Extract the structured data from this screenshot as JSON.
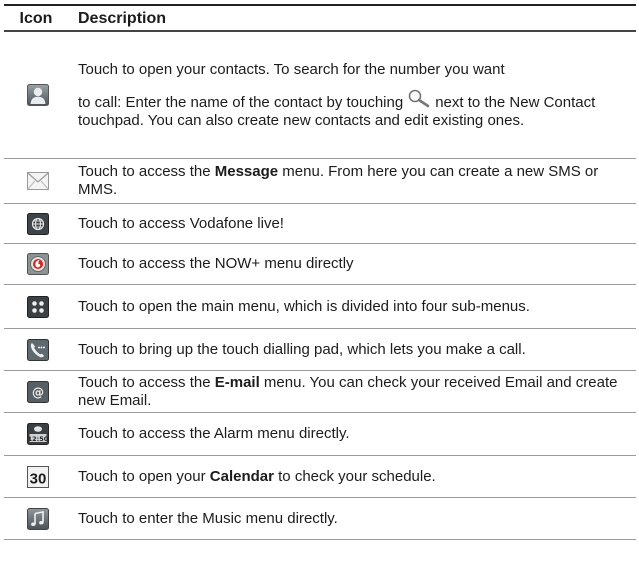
{
  "header": {
    "icon": "Icon",
    "description": "Description"
  },
  "rows": [
    {
      "icon": "contacts-icon",
      "p1": "Touch to open your contacts. To search for the number you want",
      "p2a": "to call: Enter the name of the contact by touching",
      "p2b": "next to the New Contact touchpad. You can also create new contacts and edit existing ones."
    },
    {
      "icon": "message-icon",
      "pre": "Touch to access the ",
      "bold": "Message",
      "post": " menu. From here you can create a new SMS or MMS."
    },
    {
      "icon": "vodafone-live-icon",
      "text": "Touch to access Vodafone live!"
    },
    {
      "icon": "now-plus-icon",
      "text": "Touch to access the NOW+ menu directly"
    },
    {
      "icon": "main-menu-icon",
      "text": "Touch to open the main menu, which is divided into four sub-menus."
    },
    {
      "icon": "dialling-pad-icon",
      "text": "Touch to bring up the touch dialling pad, which lets you make a call."
    },
    {
      "icon": "email-icon",
      "pre": "Touch to access the ",
      "bold": "E-mail",
      "post": " menu. You can check your received Email and create new Email."
    },
    {
      "icon": "alarm-icon",
      "icon_text": "12:50",
      "text": "Touch to access the Alarm menu directly."
    },
    {
      "icon": "calendar-icon",
      "icon_text": "30",
      "pre": "Touch to open your ",
      "bold": "Calendar",
      "post": " to check your schedule."
    },
    {
      "icon": "music-icon",
      "text": "Touch to enter the Music menu directly."
    }
  ],
  "inline_icon": "search-magnifier-icon"
}
